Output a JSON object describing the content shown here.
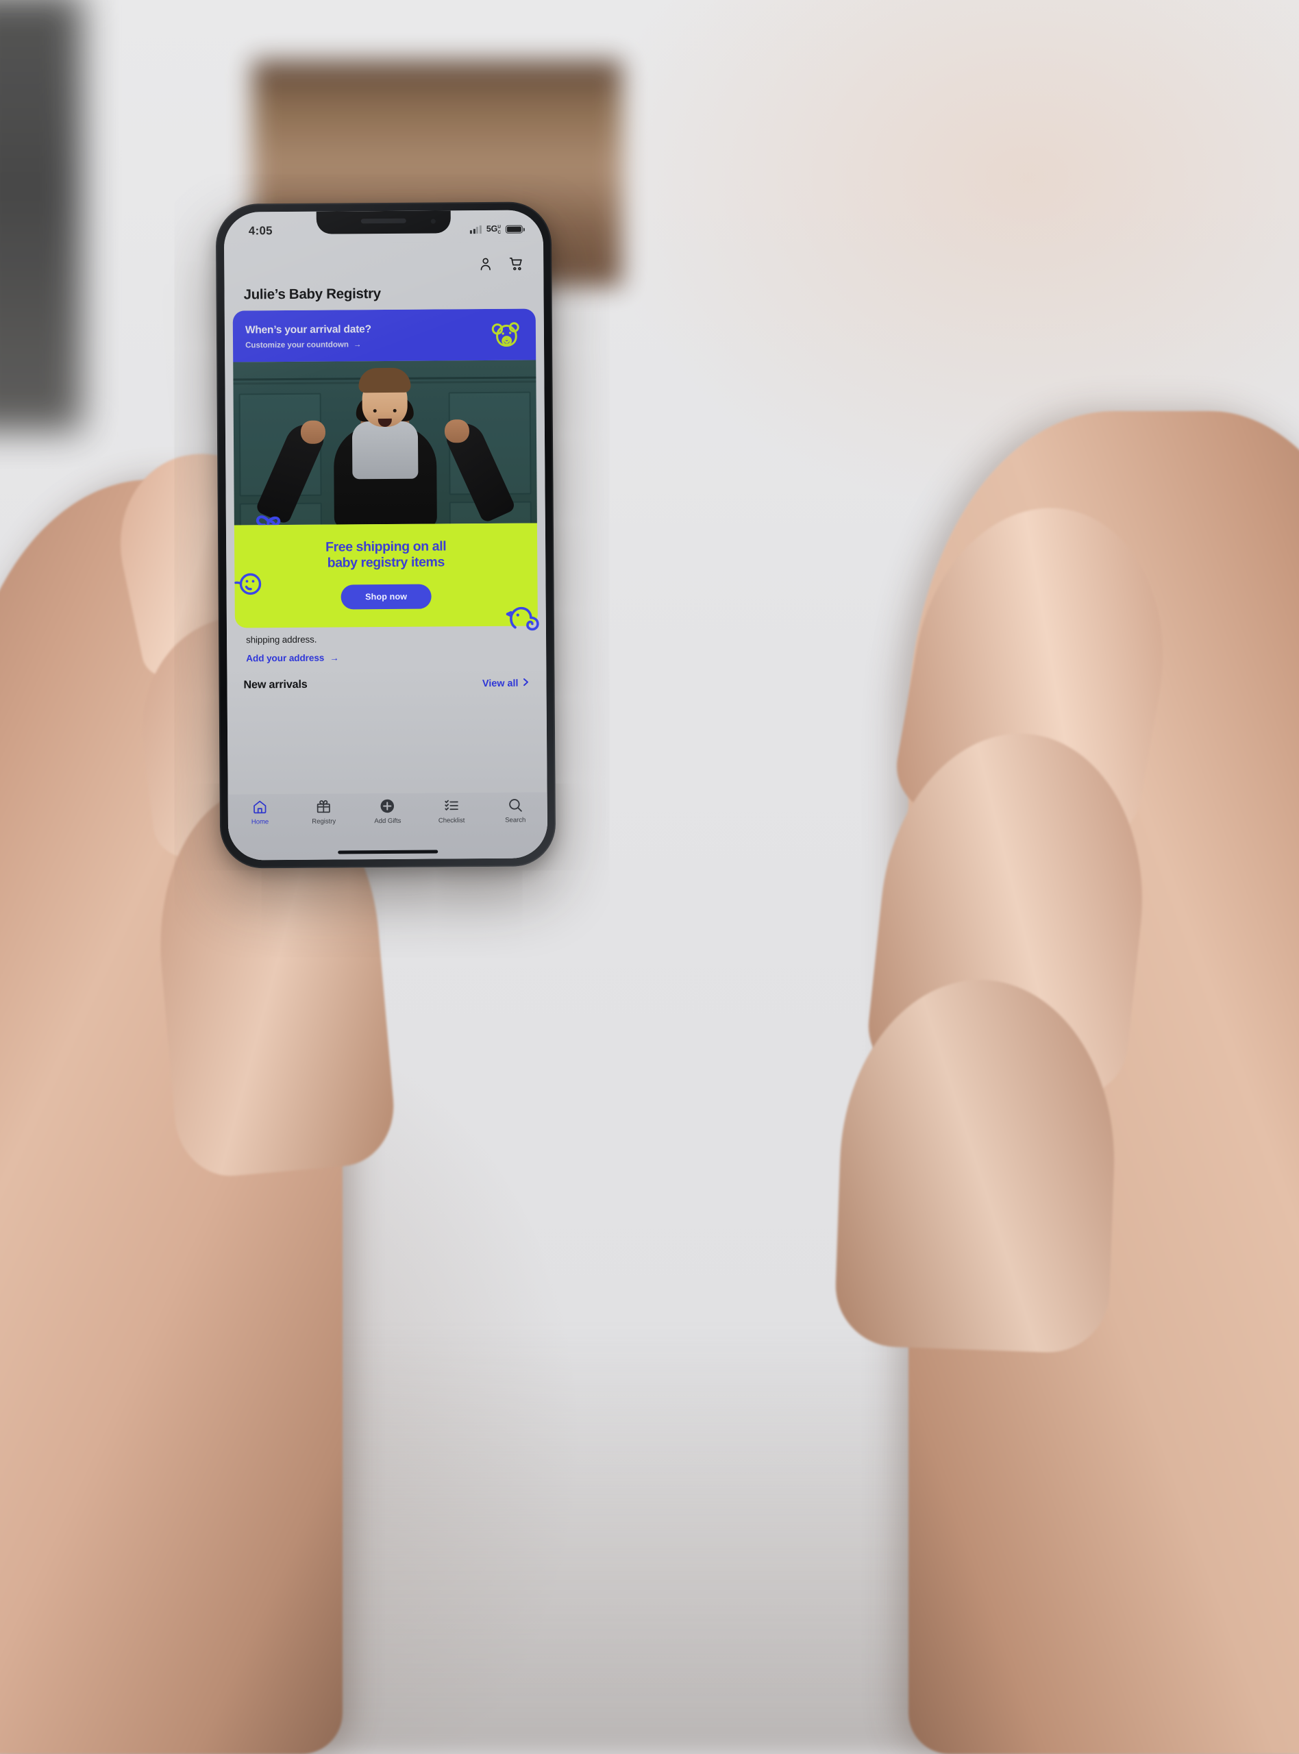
{
  "status_bar": {
    "time": "4:05",
    "network": "5G",
    "network_sup_u": "U",
    "network_sup_c": "C",
    "signal_icon": "signal-bars-icon",
    "battery_icon": "battery-full-icon"
  },
  "header": {
    "account_icon": "person-icon",
    "cart_icon": "shopping-cart-icon",
    "page_title": "Julie’s Baby Registry"
  },
  "arrival_card": {
    "title": "When’s your arrival date?",
    "subtitle": "Customize your countdown",
    "arrow": "→",
    "icon": "teddy-bear-icon",
    "bg_color": "#3b3fd4",
    "icon_color": "#b9d92a"
  },
  "hero": {
    "image_alt": "Father holding smiling baby on his shoulders in front of teal garage door",
    "decor_icon": "butterfly-icon"
  },
  "promo": {
    "line1": "Free shipping on all",
    "line2": "baby registry items",
    "button_label": "Shop now",
    "bg_color": "#c5ec2a",
    "text_color": "#3b3fd4",
    "button_bg": "#4149dd",
    "decor_left_icon": "smiley-face-icon",
    "decor_right_icon": "chick-icon"
  },
  "address_block": {
    "text": "shipping address.",
    "link_label": "Add your address",
    "link_arrow": "→",
    "link_color": "#2f37d8"
  },
  "new_arrivals": {
    "title": "New arrivals",
    "view_all_label": "View all",
    "chevron": "›"
  },
  "tabbar": {
    "items": [
      {
        "label": "Home",
        "icon": "home-icon",
        "active": true
      },
      {
        "label": "Registry",
        "icon": "gift-icon",
        "active": false
      },
      {
        "label": "Add Gifts",
        "icon": "plus-circle-icon",
        "active": false
      },
      {
        "label": "Checklist",
        "icon": "checklist-icon",
        "active": false
      },
      {
        "label": "Search",
        "icon": "search-icon",
        "active": false
      }
    ],
    "active_color": "#2f37d8"
  }
}
